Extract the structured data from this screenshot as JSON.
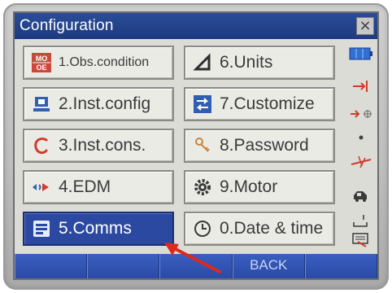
{
  "window": {
    "title": "Configuration",
    "close_glyph": "×"
  },
  "menu": [
    {
      "label": "1.Obs.condition",
      "icon": "mo-oe-icon"
    },
    {
      "label": "2.Inst.config",
      "icon": "instrument-icon"
    },
    {
      "label": "3.Inst.cons.",
      "icon": "constant-c-icon"
    },
    {
      "label": "4.EDM",
      "icon": "edm-icon"
    },
    {
      "label": "5.Comms",
      "icon": "comms-icon",
      "selected": true
    },
    {
      "label": "6.Units",
      "icon": "triangle-icon"
    },
    {
      "label": "7.Customize",
      "icon": "customize-arrows-icon"
    },
    {
      "label": "8.Password",
      "icon": "key-icon"
    },
    {
      "label": "9.Motor",
      "icon": "gear-icon"
    },
    {
      "label": "0.Date & time",
      "icon": "clock-icon"
    }
  ],
  "icon_text": {
    "mo_top": "MO",
    "mo_bottom": "OE"
  },
  "softkeys": [
    "",
    "",
    "",
    "BACK",
    ""
  ],
  "colors": {
    "title_bar": "#1d3a7e",
    "selected": "#2c49a2",
    "softkey_bar": "#2a4aa6",
    "icon_red": "#d23b2e",
    "arrow_red": "#e0281e"
  }
}
